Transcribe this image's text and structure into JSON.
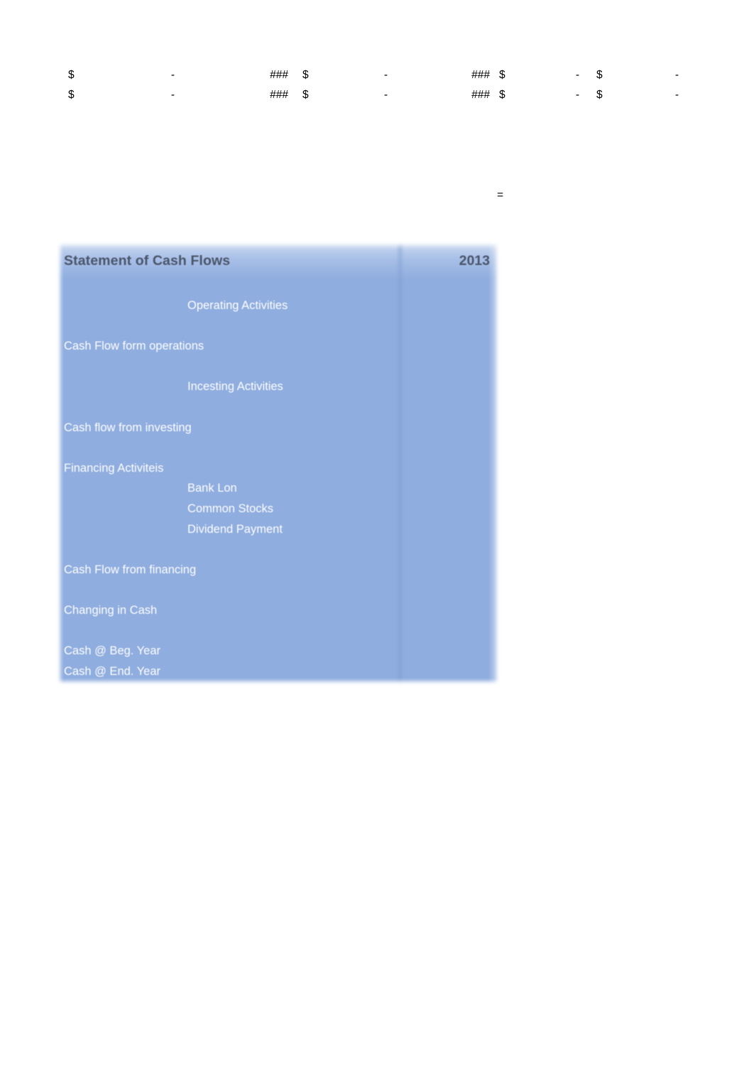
{
  "spreadsheet": {
    "numeric_rows": [
      {
        "currency_1": "$",
        "value_1": "-",
        "overflow_1": "###",
        "currency_2": "$",
        "value_2": "-",
        "overflow_2": "###",
        "currency_3": "$",
        "value_3": "-",
        "currency_4": "$",
        "value_4": "-"
      },
      {
        "currency_1": "$",
        "value_1": "-",
        "overflow_1": "###",
        "currency_2": "$",
        "value_2": "-",
        "overflow_2": "###",
        "currency_3": "$",
        "value_3": "-",
        "currency_4": "$",
        "value_4": "-"
      }
    ],
    "equals_marker": "="
  },
  "cash_flow_statement": {
    "title": "Statement of Cash Flows",
    "year": "2013",
    "colors": {
      "panel_blue": "#8fadde",
      "header_blue": "#a9c0e8",
      "title_text": "#4a5569",
      "body_text": "#ffffff",
      "divider": "#7d9ace"
    },
    "rows": [
      {
        "label": "Operating Activities",
        "indent": 1,
        "amount": ""
      },
      {
        "label": "",
        "indent": 0,
        "amount": ""
      },
      {
        "label": "Cash Flow form operations",
        "indent": 0,
        "amount": ""
      },
      {
        "label": "",
        "indent": 0,
        "amount": ""
      },
      {
        "label": "Incesting Activities",
        "indent": 1,
        "amount": ""
      },
      {
        "label": "",
        "indent": 0,
        "amount": ""
      },
      {
        "label": "Cash flow from investing",
        "indent": 0,
        "amount": ""
      },
      {
        "label": "",
        "indent": 0,
        "amount": ""
      },
      {
        "label": "Financing Activiteis",
        "indent": 0,
        "amount": ""
      },
      {
        "label": "Bank Lon",
        "indent": 1,
        "amount": ""
      },
      {
        "label": "Common Stocks",
        "indent": 1,
        "amount": ""
      },
      {
        "label": "Dividend Payment",
        "indent": 1,
        "amount": ""
      },
      {
        "label": "",
        "indent": 0,
        "amount": ""
      },
      {
        "label": "Cash Flow from financing",
        "indent": 0,
        "amount": ""
      },
      {
        "label": "",
        "indent": 0,
        "amount": ""
      },
      {
        "label": "Changing in Cash",
        "indent": 0,
        "amount": ""
      },
      {
        "label": "",
        "indent": 0,
        "amount": ""
      },
      {
        "label": "Cash @ Beg. Year",
        "indent": 0,
        "amount": ""
      },
      {
        "label": "Cash @ End. Year",
        "indent": 0,
        "amount": ""
      }
    ]
  }
}
